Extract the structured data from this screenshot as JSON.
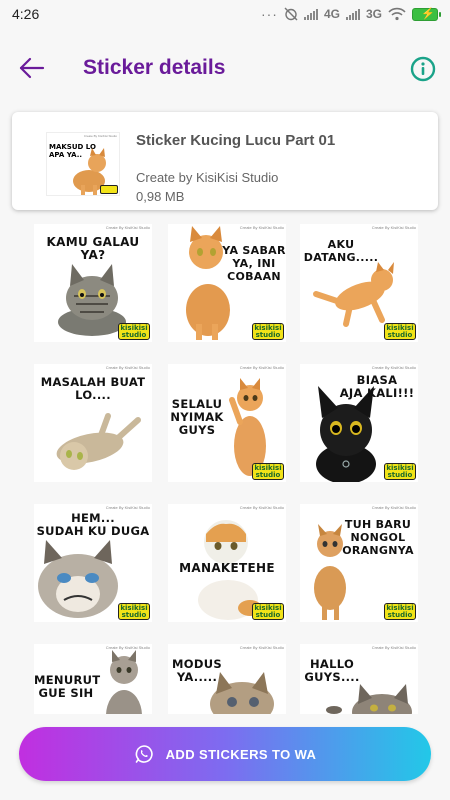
{
  "status_bar": {
    "time": "4:26",
    "dots": "···",
    "network_1": "4G",
    "network_2": "3G"
  },
  "header": {
    "title": "Sticker details",
    "back_icon": "arrow-left-icon",
    "info_icon": "info-icon"
  },
  "pack": {
    "name": "Sticker Kucing Lucu Part 01",
    "author": "Create by KisiKisi Studio",
    "size": "0,98 MB",
    "thumb_caption": "MAKSUD LO\nAPA YA..",
    "thumb_credit": "Create By KisiKisi Studio"
  },
  "stickers": [
    {
      "caption": "KAMU GALAU\nYA?",
      "credit": "Create By KisiKisi Studio",
      "brand": "kisikisi\nstudio"
    },
    {
      "caption": "YA SABAR\nYA, INI\nCOBAAN",
      "credit": "Create By KisiKisi Studio",
      "brand": "kisikisi\nstudio"
    },
    {
      "caption": "AKU\nDATANG.....",
      "credit": "Create By KisiKisi Studio",
      "brand": "kisikisi\nstudio"
    },
    {
      "caption": "MASALAH BUAT\nLO....",
      "credit": "Create By KisiKisi Studio",
      "brand": ""
    },
    {
      "caption": "SELALU\nNYIMAK\nGUYS",
      "credit": "Create By KisiKisi Studio",
      "brand": "kisikisi\nstudio"
    },
    {
      "caption": "BIASA\nAJA KALI!!!",
      "credit": "Create By KisiKisi Studio",
      "brand": "kisikisi\nstudio"
    },
    {
      "caption": "HEM...\nSUDAH KU DUGA",
      "credit": "Create By KisiKisi Studio",
      "brand": "kisikisi\nstudio"
    },
    {
      "caption": "MANAKETEHE",
      "credit": "Create By KisiKisi Studio",
      "brand": "kisikisi\nstudio"
    },
    {
      "caption": "TUH BARU\nNONGOL\nORANGNYA",
      "credit": "Create By KisiKisi Studio",
      "brand": "kisikisi\nstudio"
    },
    {
      "caption": "MENURUT\nGUE SIH",
      "credit": "Create By KisiKisi Studio",
      "brand": ""
    },
    {
      "caption": "MODUS\nYA.....",
      "credit": "Create By KisiKisi Studio",
      "brand": ""
    },
    {
      "caption": "HALLO\nGUYS....",
      "credit": "Create By KisiKisi Studio",
      "brand": ""
    }
  ],
  "cta": {
    "label": "ADD STICKERS TO WA",
    "icon": "whatsapp-icon"
  },
  "colors": {
    "title_purple": "#6a1b9a",
    "accent_teal": "#1aa389",
    "gradient_start": "#c12fe0",
    "gradient_end": "#22c8e8",
    "brand_yellow": "#f2e318"
  }
}
